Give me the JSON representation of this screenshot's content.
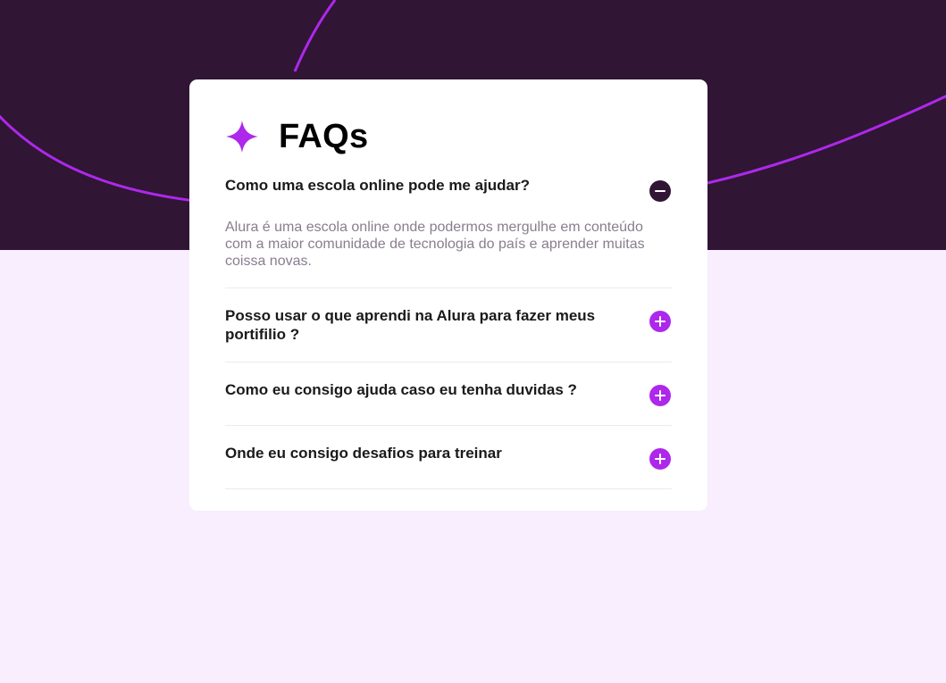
{
  "colors": {
    "hero_background": "#301534",
    "page_background": "#f8eefe",
    "accent": "#ad28eb",
    "card": "#ffffff",
    "answer_text": "#8a7d8e"
  },
  "header": {
    "icon": "star-icon",
    "title": "FAQs"
  },
  "faqs": [
    {
      "question": "Como uma escola online pode me ajudar?",
      "answer": "Alura é uma escola online onde podermos mergulhe em conteúdo com a maior comunidade de tecnologia do país e aprender muitas coissa novas.",
      "expanded": true,
      "icon": "minus-circle-icon"
    },
    {
      "question": "Posso usar o que aprendi na Alura para fazer meus portifilio ?",
      "expanded": false,
      "icon": "plus-circle-icon"
    },
    {
      "question": "Como eu consigo ajuda caso eu tenha duvidas ?",
      "expanded": false,
      "icon": "plus-circle-icon"
    },
    {
      "question": "Onde eu consigo desafios para treinar",
      "expanded": false,
      "icon": "plus-circle-icon"
    }
  ]
}
